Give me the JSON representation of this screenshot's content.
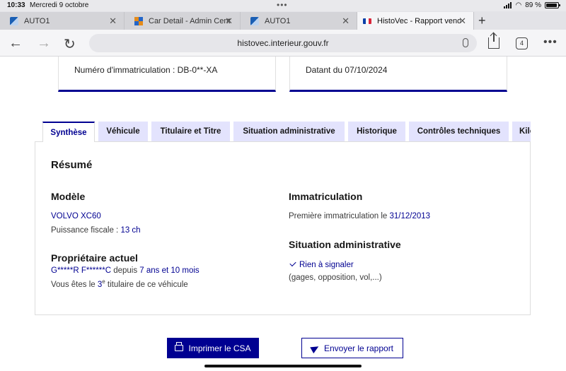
{
  "status_bar": {
    "time": "10:33",
    "date": "Mercredi 9 octobre",
    "battery": "89 %"
  },
  "browser": {
    "tabs": [
      {
        "label": "AUTO1",
        "icon": "auto1-favicon-icon",
        "active": false
      },
      {
        "label": "Car Detail - Admin Cente",
        "icon": "admin-center-favicon-icon",
        "active": false
      },
      {
        "label": "AUTO1",
        "icon": "auto1-favicon-icon",
        "active": false
      },
      {
        "label": "HistoVec - Rapport vendi",
        "icon": "french-flag-icon",
        "active": true
      }
    ],
    "url": "histovec.interieur.gouv.fr",
    "tab_count": "4"
  },
  "summary_cards": {
    "plate": "Numéro d'immatriculation : DB-0**-XA",
    "date": "Datant du 07/10/2024"
  },
  "page_tabs": [
    "Synthèse",
    "Véhicule",
    "Titulaire et Titre",
    "Situation administrative",
    "Historique",
    "Contrôles techniques",
    "Kilo"
  ],
  "resume": {
    "heading": "Résumé",
    "modele": {
      "heading": "Modèle",
      "model": "VOLVO XC60",
      "power_label": "Puissance fiscale : ",
      "power_value": "13 ch"
    },
    "proprietaire": {
      "heading": "Propriétaire actuel",
      "owner": "G*****R F******C",
      "since_label": " depuis ",
      "since_value": "7 ans et 10 mois",
      "rank_prefix": "Vous êtes le ",
      "rank_value": "3",
      "rank_sup": "e",
      "rank_suffix": " titulaire de ce véhicule"
    },
    "immatriculation": {
      "heading": "Immatriculation",
      "label": "Première immatriculation le ",
      "value": "31/12/2013"
    },
    "situation": {
      "heading": "Situation administrative",
      "status": "Rien à signaler",
      "detail": "(gages, opposition, vol,...)"
    }
  },
  "actions": {
    "print": "Imprimer le CSA",
    "send": "Envoyer le rapport"
  },
  "colors": {
    "primary": "#000091",
    "tab_bg": "#e3e3fd"
  }
}
